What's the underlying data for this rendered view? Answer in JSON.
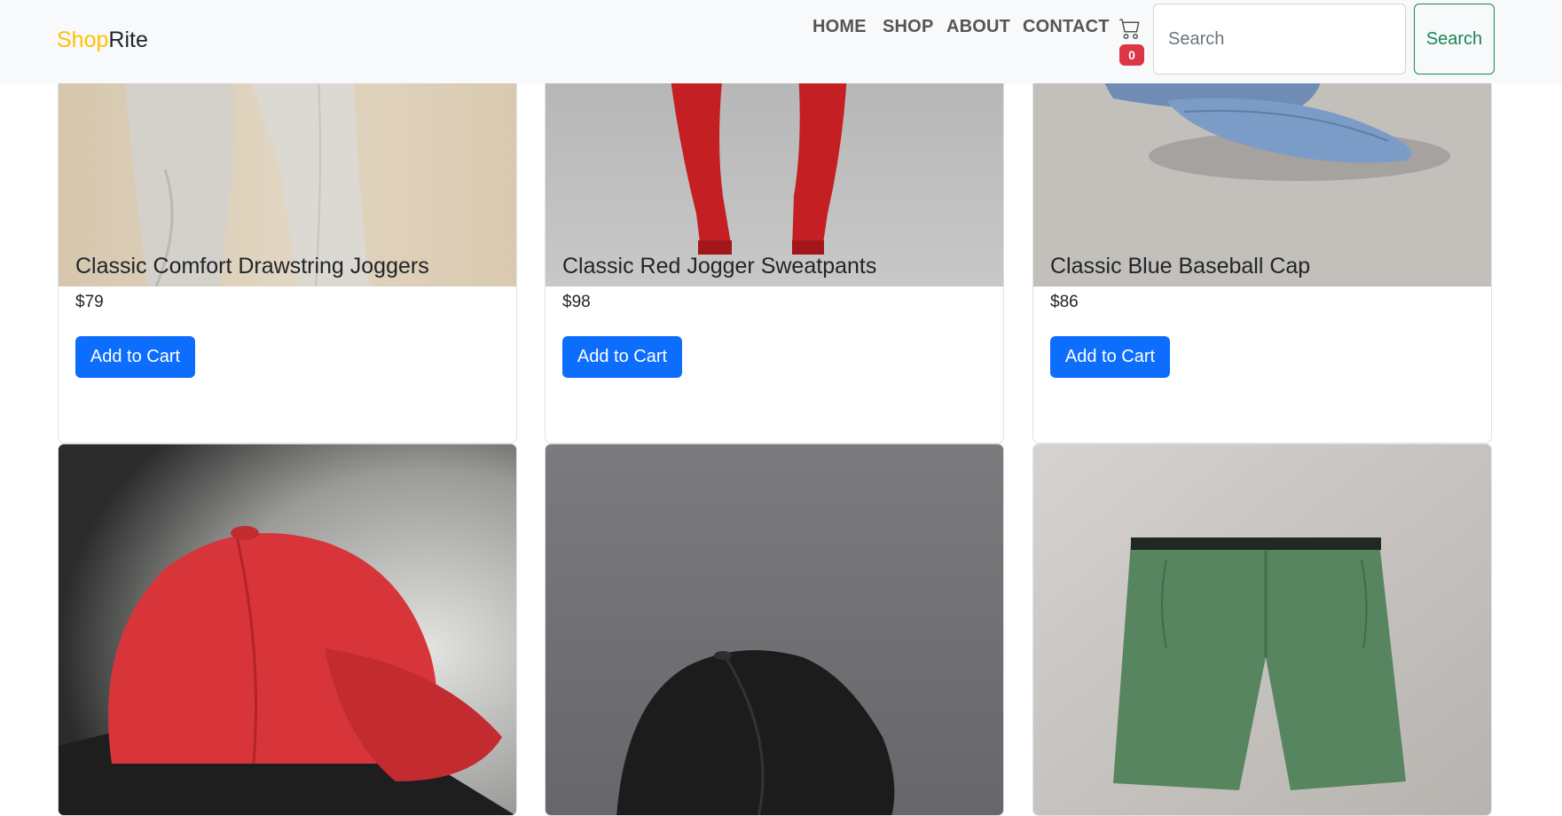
{
  "navbar": {
    "brand_part1": "Shop",
    "brand_part2": "Rite",
    "links": [
      "HOME",
      "SHOP",
      "ABOUT",
      "CONTACT"
    ],
    "cart_count": "0",
    "search_placeholder": "Search",
    "search_button": "Search"
  },
  "products": [
    {
      "title": "Classic Comfort Drawstring Joggers",
      "price": "$79",
      "button": "Add to Cart"
    },
    {
      "title": "Classic Red Jogger Sweatpants",
      "price": "$98",
      "button": "Add to Cart"
    },
    {
      "title": "Classic Blue Baseball Cap",
      "price": "$86",
      "button": "Add to Cart"
    },
    {
      "title": "",
      "price": "",
      "button": ""
    },
    {
      "title": "",
      "price": "",
      "button": ""
    },
    {
      "title": "",
      "price": "",
      "button": ""
    }
  ],
  "colors": {
    "brand_accent": "#ffc107",
    "primary_button": "#0d6efd",
    "success_outline": "#198754",
    "badge": "#dc3545",
    "navbar_bg": "#f8f9fa"
  }
}
